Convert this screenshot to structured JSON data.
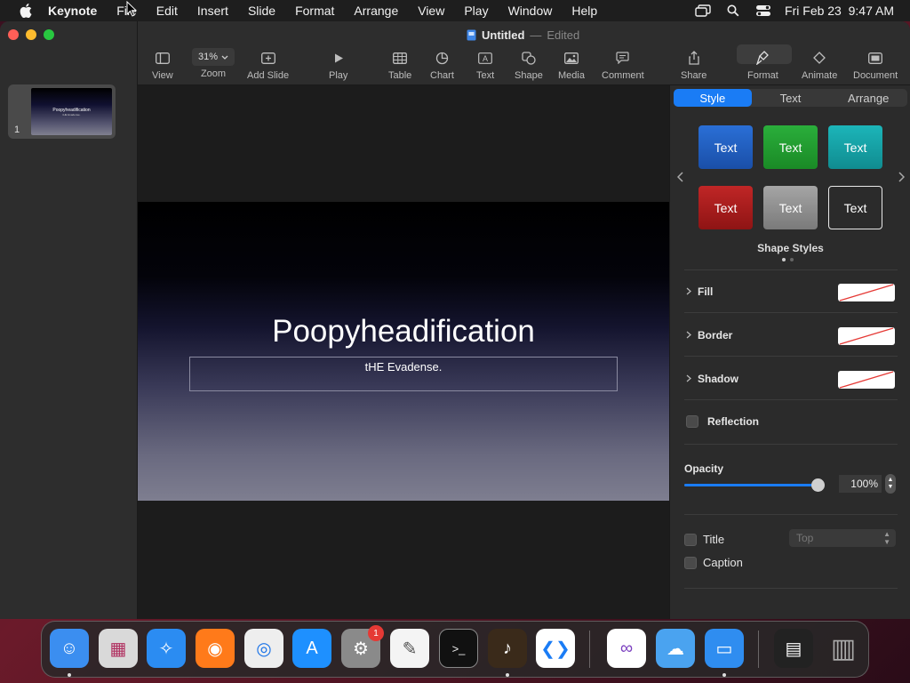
{
  "menubar": {
    "app_name": "Keynote",
    "items": [
      "File",
      "Edit",
      "Insert",
      "Slide",
      "Format",
      "Arrange",
      "View",
      "Play",
      "Window",
      "Help"
    ],
    "icons": [
      "screen-mirroring-icon",
      "search-icon",
      "control-center-icon"
    ],
    "clock": "Fri Feb 23  9:47 AM"
  },
  "window": {
    "title": "Untitled",
    "title_separator": "—",
    "status": "Edited",
    "traffic_colors": [
      "#ff5f57",
      "#febc2e",
      "#28c840"
    ]
  },
  "toolbar": {
    "zoom_value": "31%",
    "buttons": [
      {
        "label": "View",
        "icon": "sidebar-icon"
      },
      {
        "label": "Zoom",
        "icon": "zoom-icon"
      },
      {
        "label": "Add Slide",
        "icon": "add-slide-icon"
      },
      {
        "label": "Play",
        "icon": "play-icon"
      },
      {
        "label": "Table",
        "icon": "table-icon"
      },
      {
        "label": "Chart",
        "icon": "chart-icon"
      },
      {
        "label": "Text",
        "icon": "text-box-icon"
      },
      {
        "label": "Shape",
        "icon": "shape-icon"
      },
      {
        "label": "Media",
        "icon": "media-icon"
      },
      {
        "label": "Comment",
        "icon": "comment-icon"
      },
      {
        "label": "Share",
        "icon": "share-icon"
      },
      {
        "label": "Format",
        "icon": "paintbrush-icon"
      },
      {
        "label": "Animate",
        "icon": "animate-icon"
      },
      {
        "label": "Document",
        "icon": "document-icon"
      }
    ]
  },
  "navigator": {
    "slides": [
      {
        "number": "1",
        "title": "Poopyheadification",
        "subtitle": "tHE Evadense."
      }
    ]
  },
  "slide": {
    "title": "Poopyheadification",
    "subtitle": "tHE Evadense."
  },
  "inspector": {
    "tabs": [
      {
        "label": "Style",
        "active": true
      },
      {
        "label": "Text",
        "active": false
      },
      {
        "label": "Arrange",
        "active": false
      }
    ],
    "shape_styles": [
      {
        "label": "Text",
        "color": "#1b5fc4"
      },
      {
        "label": "Text",
        "color": "#1f9a2e"
      },
      {
        "label": "Text",
        "color": "#14a3a8"
      },
      {
        "label": "Text",
        "color": "#b01e1e"
      },
      {
        "label": "Text",
        "color": "#8e8e8e"
      },
      {
        "label": "Text",
        "color": "transparent"
      }
    ],
    "shape_styles_label": "Shape Styles",
    "properties": {
      "fill": "Fill",
      "border": "Border",
      "shadow": "Shadow",
      "reflection": "Reflection"
    },
    "opacity_label": "Opacity",
    "opacity_value": "100%",
    "opacity_fraction": 1.0,
    "title_label": "Title",
    "caption_label": "Caption",
    "title_position": "Top",
    "accent": "#1a7cf5"
  },
  "dock": {
    "apps": [
      {
        "name": "finder-icon",
        "color": "#3b8ef0",
        "running": true
      },
      {
        "name": "launchpad-icon",
        "color": "#d9d9d9",
        "running": false
      },
      {
        "name": "safari-icon",
        "color": "#2b8cf2",
        "running": false
      },
      {
        "name": "firefox-icon",
        "color": "#ff7a1a",
        "running": false
      },
      {
        "name": "chrome-icon",
        "color": "#eeeeee",
        "running": false
      },
      {
        "name": "app-store-icon",
        "color": "#1e90ff",
        "running": false
      },
      {
        "name": "system-settings-icon",
        "color": "#8a8a8a",
        "running": false,
        "badge": "1"
      },
      {
        "name": "textedit-icon",
        "color": "#f4f4f4",
        "running": false
      },
      {
        "name": "terminal-icon",
        "color": "#111111",
        "running": false
      },
      {
        "name": "garageband-icon",
        "color": "#3a2a1a",
        "running": true
      },
      {
        "name": "vscode-icon",
        "color": "#ffffff",
        "running": false
      },
      {
        "name": "visual-studio-icon",
        "color": "#ffffff",
        "running": false
      },
      {
        "name": "weather-icon",
        "color": "#4aa3f0",
        "running": false
      },
      {
        "name": "keynote-icon",
        "color": "#2f8df0",
        "running": true
      },
      {
        "name": "downloads-stack-icon",
        "color": "#222222",
        "running": false
      },
      {
        "name": "trash-icon",
        "color": "#777777",
        "running": false
      }
    ]
  }
}
